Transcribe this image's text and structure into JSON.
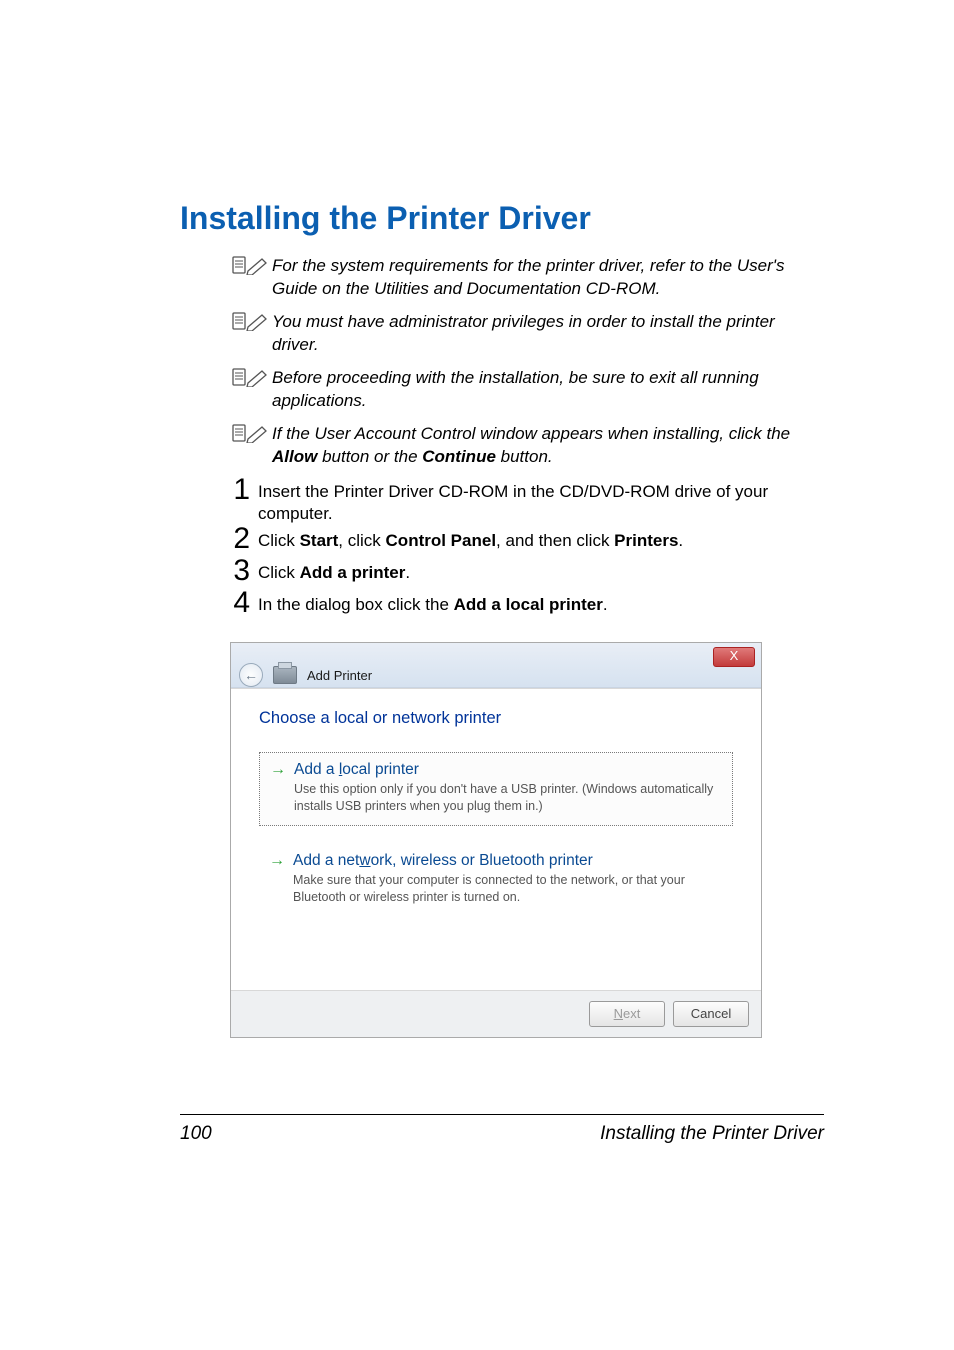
{
  "heading": "Installing the Printer Driver",
  "notes": [
    "For the system requirements for the printer driver, refer to the User's Guide on the Utilities and Documentation CD-ROM.",
    "You must have administrator privileges in order to install the printer driver.",
    "Before proceeding with the installation, be sure to exit all running applications."
  ],
  "note4": {
    "pre": "If the User Account Control window appears when installing, click the ",
    "b1": "Allow",
    "mid": " button or the ",
    "b2": "Continue",
    "post": " button."
  },
  "steps": {
    "s1": "Insert the Printer Driver CD-ROM in the CD/DVD-ROM drive of your computer.",
    "s2": {
      "t0": "Click ",
      "b1": "Start",
      "t1": ", click ",
      "b2": "Control Panel",
      "t2": ", and then click ",
      "b3": "Printers",
      "t3": "."
    },
    "s3": {
      "t0": "Click ",
      "b1": "Add a printer",
      "t1": "."
    },
    "s4": {
      "t0": "In the dialog box click the ",
      "b1": "Add a local printer",
      "t1": "."
    }
  },
  "dialog": {
    "close_glyph": "X",
    "back_glyph": "←",
    "breadcrumb": "Add Printer",
    "heading": "Choose a local or network printer",
    "opt1": {
      "pre": "Add a ",
      "u": "l",
      "post": "ocal printer",
      "desc": "Use this option only if you don't have a USB printer. (Windows automatically installs USB printers when you plug them in.)"
    },
    "opt2": {
      "pre": "Add a net",
      "u": "w",
      "post": "ork, wireless or Bluetooth printer",
      "desc": "Make sure that your computer is connected to the network, or that your Bluetooth or wireless printer is turned on."
    },
    "next": {
      "u": "N",
      "rest": "ext"
    },
    "cancel": "Cancel"
  },
  "footer": {
    "page": "100",
    "title": "Installing the Printer Driver"
  }
}
